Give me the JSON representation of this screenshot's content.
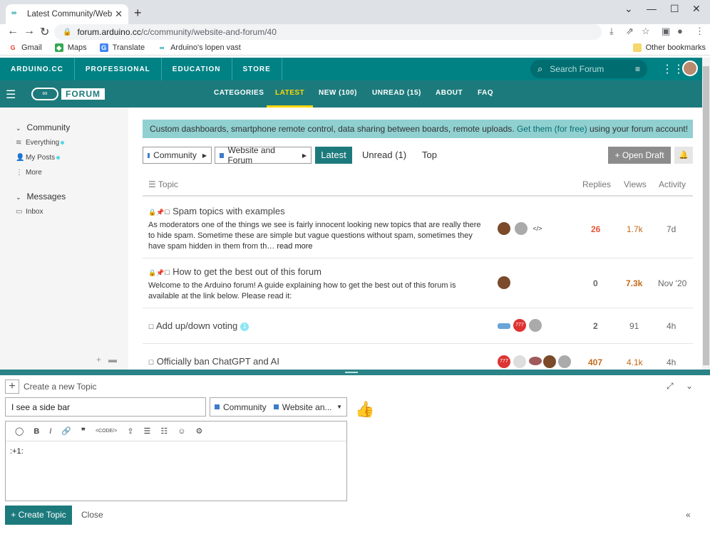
{
  "browser": {
    "tab_title": "Latest Community/Website and F",
    "url_host": "forum.arduino.cc",
    "url_path": "/c/community/website-and-forum/40",
    "bookmarks": [
      "Gmail",
      "Maps",
      "Translate",
      "Arduino's lopen vast"
    ],
    "other_bookmarks": "Other bookmarks"
  },
  "topnav": {
    "items": [
      "ARDUINO.CC",
      "PROFESSIONAL",
      "EDUCATION",
      "STORE"
    ],
    "search_placeholder": "Search Forum"
  },
  "forumnav": {
    "logo": "FORUM",
    "items": [
      "CATEGORIES",
      "LATEST",
      "NEW (100)",
      "UNREAD (15)",
      "ABOUT",
      "FAQ"
    ],
    "active": "LATEST"
  },
  "sidebar": {
    "community": "Community",
    "community_items": [
      "Everything",
      "My Posts",
      "More"
    ],
    "messages": "Messages",
    "messages_items": [
      "Inbox"
    ]
  },
  "banner": {
    "text_before": "Custom dashboards, smartphone remote control, data sharing between boards, remote uploads. ",
    "link": "Get them (for free)",
    "text_after": " using your forum account!"
  },
  "filters": {
    "crumb1": "Community",
    "crumb2": "Website and Forum",
    "latest": "Latest",
    "unread": "Unread (1)",
    "top": "Top",
    "open_draft": "Open Draft"
  },
  "table": {
    "headers": [
      "Topic",
      "Replies",
      "Views",
      "Activity"
    ],
    "rows": [
      {
        "title": "Spam topics with examples",
        "excerpt": "As moderators one of the things we see is fairly innocent looking new topics that are really there to hide spam. Sometime these are simple but vague questions without spam, sometimes they have spam hidden in them from th…",
        "more": "read more",
        "replies": "26",
        "views": "1.7k",
        "activity": "7d"
      },
      {
        "title": "How to get the best out of this forum",
        "excerpt": "Welcome to the Arduino forum! A guide explaining how to get the best out of this forum is available at the link below. Please read it:",
        "replies": "0",
        "views": "7.3k",
        "activity": "Nov '20"
      },
      {
        "title": "Add up/down voting",
        "badge": "1",
        "replies": "2",
        "views": "91",
        "activity": "4h"
      },
      {
        "title": "Officially ban ChatGPT and AI",
        "replies": "407",
        "views": "4.1k",
        "activity": "4h"
      }
    ]
  },
  "composer": {
    "title": "Create a new Topic",
    "title_value": "I see a side bar",
    "cat1": "Community",
    "cat2": "Website an...",
    "toolbar_code": "<CODE/>",
    "body": ":+1:",
    "create": "Create Topic",
    "close": "Close"
  },
  "colors": {
    "teal": "#008184",
    "teal_dark": "#1d7a7c",
    "active": "#ffd700",
    "hot": "#e45735"
  }
}
